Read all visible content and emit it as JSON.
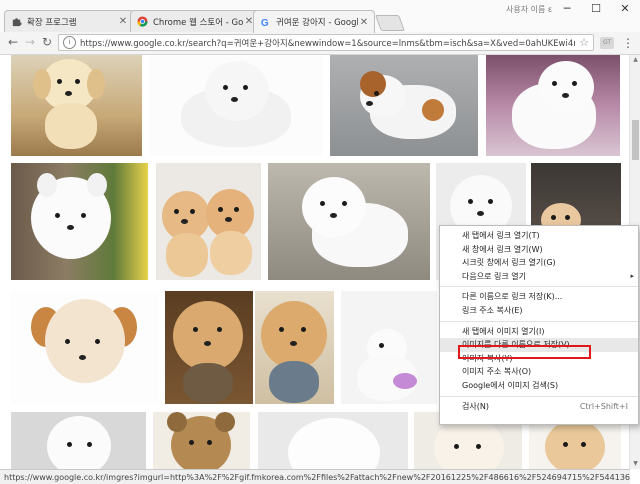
{
  "browser": {
    "tabs": [
      {
        "label": "확장 프로그램",
        "icon": "puzzle-icon"
      },
      {
        "label": "Chrome 웹 스토어 - Go",
        "icon": "chrome-store-icon"
      },
      {
        "label": "귀여운 강아지 - Google",
        "icon": "google-icon"
      }
    ],
    "profile": "사용자 이름 ε",
    "window_controls": {
      "minimize": "─",
      "maximize": "☐",
      "close": "✕"
    },
    "url": "https://www.google.co.kr/search?q=귀여운+강아지&newwindow=1&source=lnms&tbm=isch&sa=X&ved=0ahUKEwi4rpTF...",
    "ext_label": "GT",
    "status_url": "https://www.google.co.kr/imgres?imgurl=http%3A%2F%2Fgif.fmkorea.com%2Ffiles%2Fattach%2Fnew%2F20161225%2F486616%2F524694715%2F544136635%2F355510408e66b2..."
  },
  "context_menu": {
    "groups": [
      [
        {
          "label": "새 탭에서 링크 열기(T)"
        },
        {
          "label": "새 창에서 링크 열기(W)"
        },
        {
          "label": "시크릿 창에서 링크 열기(G)"
        },
        {
          "label": "다음으로 링크 열기",
          "submenu": "▸"
        }
      ],
      [
        {
          "label": "다른 이름으로 링크 저장(K)..."
        },
        {
          "label": "링크 주소 복사(E)"
        }
      ],
      [
        {
          "label": "새 탭에서 이미지 열기(I)"
        },
        {
          "label": "이미지를 다른 이름으로 저장(V)...",
          "highlighted": true
        },
        {
          "label": "이미지 복사(Y)"
        },
        {
          "label": "이미지 주소 복사(O)"
        },
        {
          "label": "Google에서 이미지 검색(S)"
        }
      ],
      [
        {
          "label": "검사(N)",
          "shortcut": "Ctrl+Shift+I"
        }
      ]
    ]
  },
  "colors": {
    "highlight_border": "#e0191b",
    "chrome_bg": "#f4f4f4"
  }
}
